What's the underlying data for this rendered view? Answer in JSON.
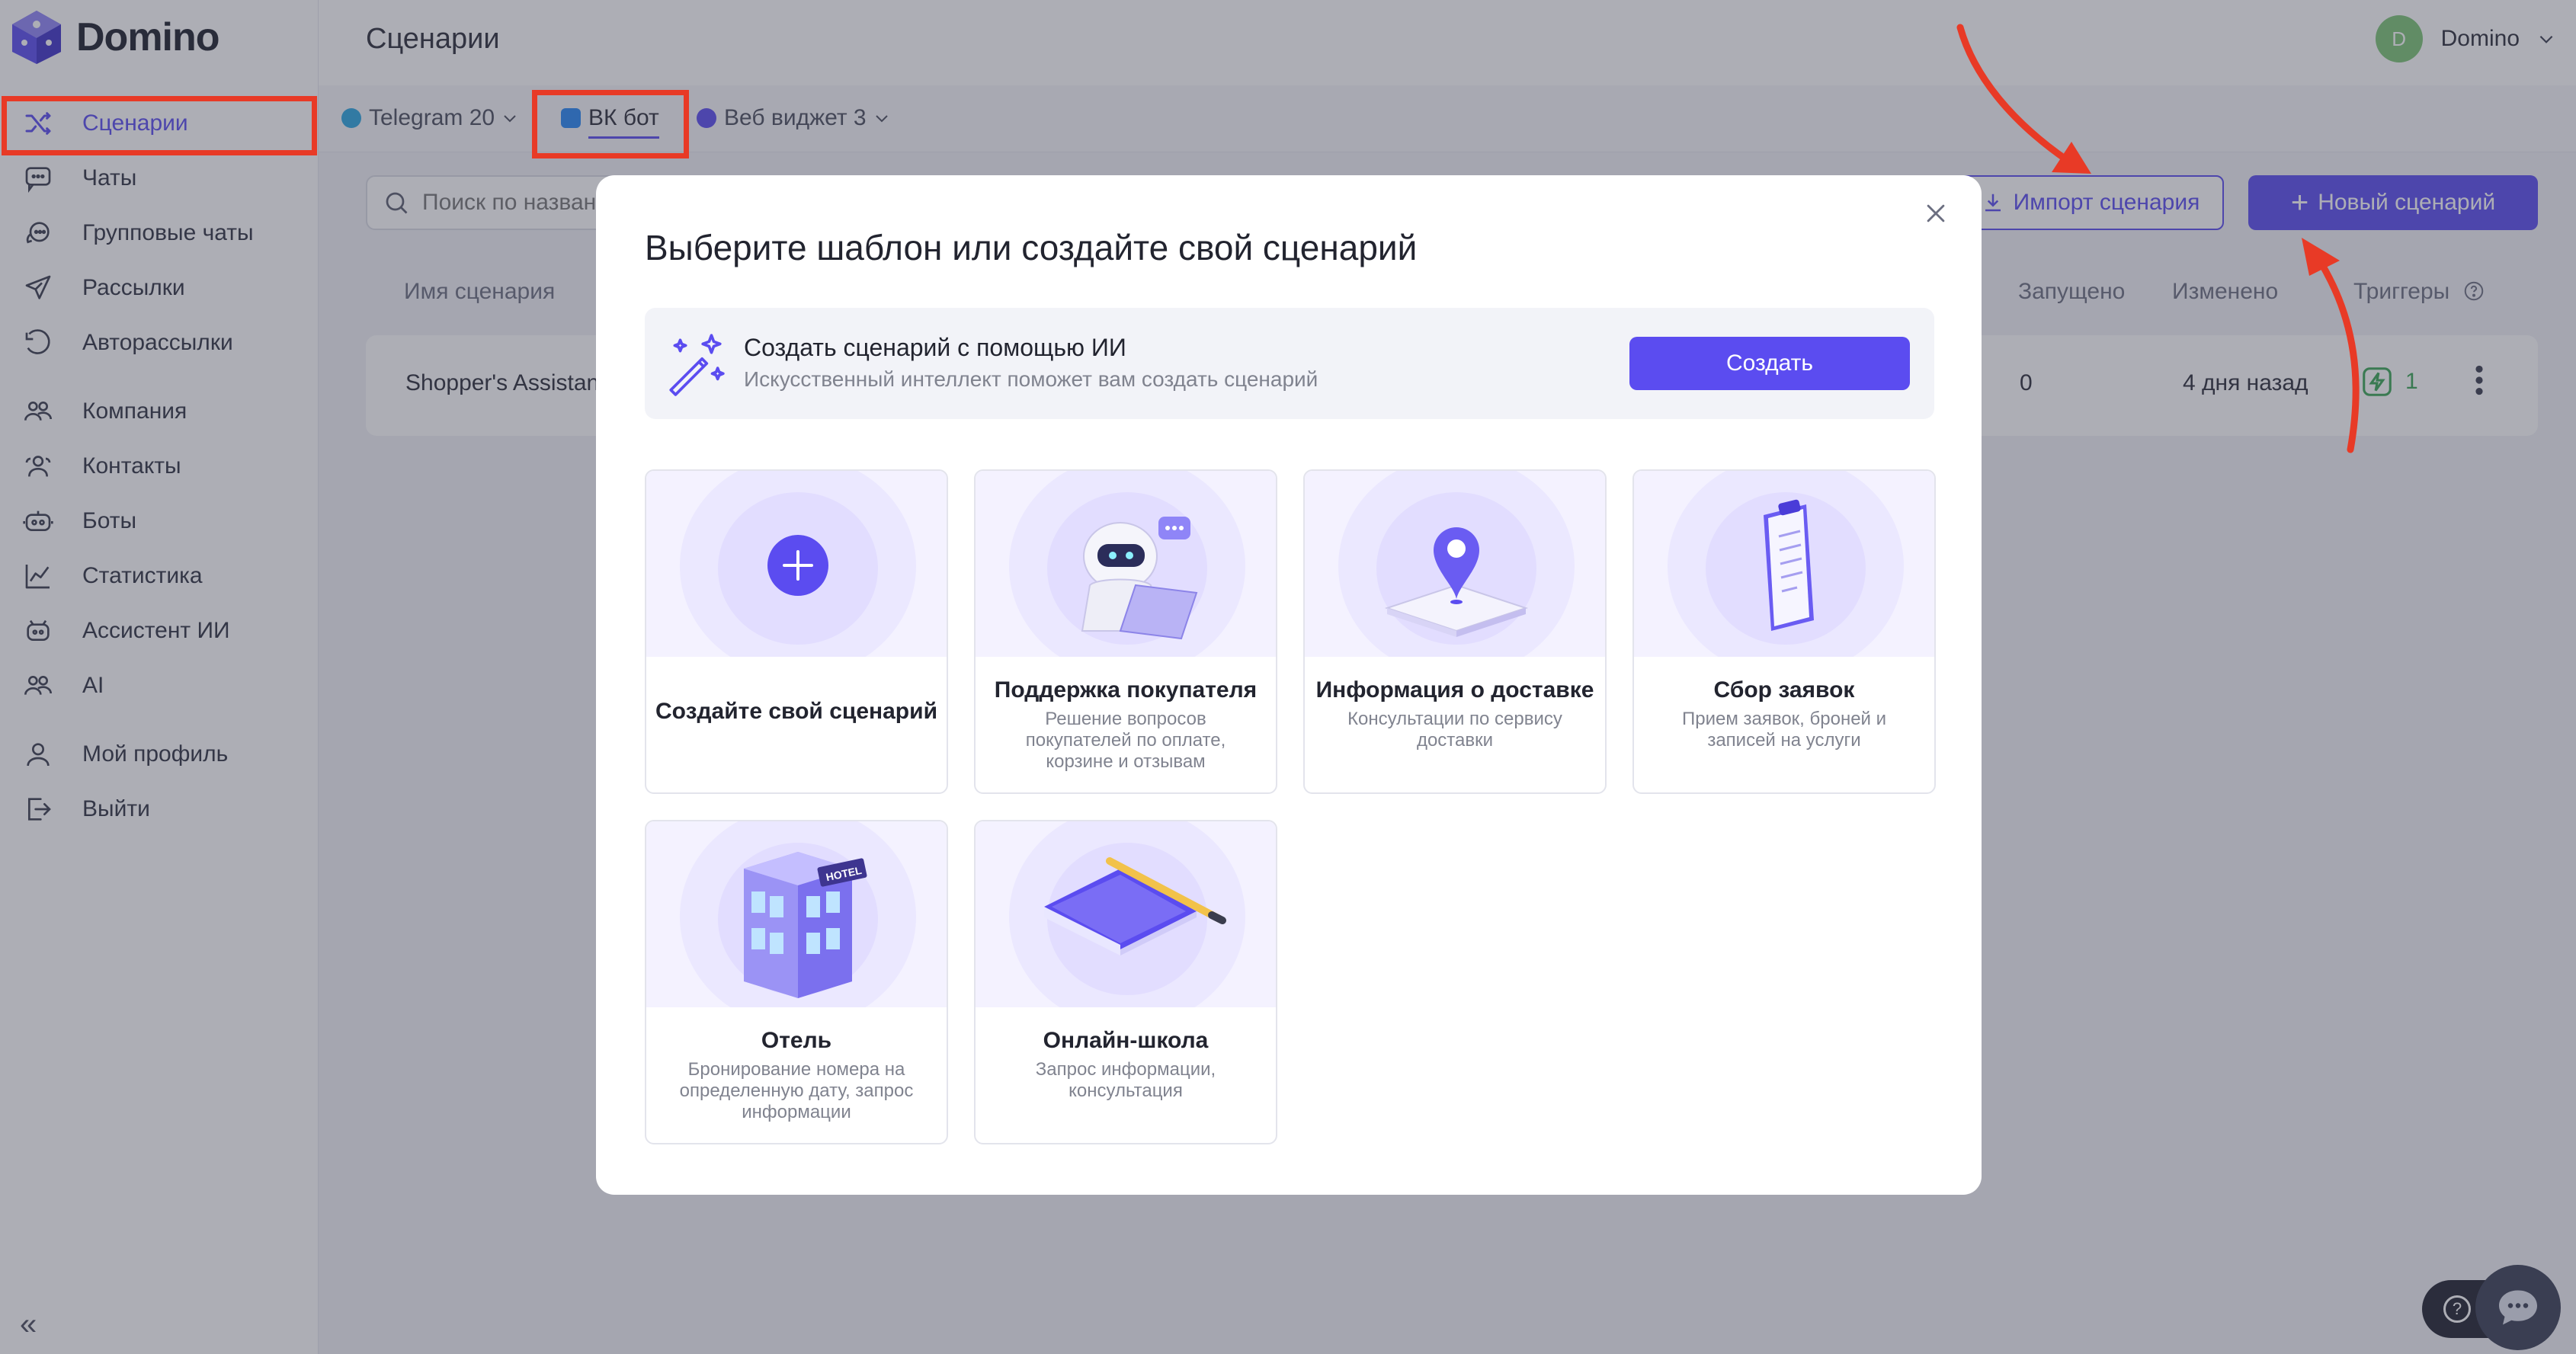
{
  "app": {
    "name": "Domino"
  },
  "sidebar": {
    "items": [
      {
        "label": "Сценарии",
        "icon": "shuffle-icon",
        "active": true
      },
      {
        "label": "Чаты",
        "icon": "chat-icon"
      },
      {
        "label": "Групповые чаты",
        "icon": "group-chat-icon"
      },
      {
        "label": "Рассылки",
        "icon": "send-icon"
      },
      {
        "label": "Авторассылки",
        "icon": "auto-send-icon"
      },
      {
        "label": "Компания",
        "icon": "company-icon"
      },
      {
        "label": "Контакты",
        "icon": "contacts-icon"
      },
      {
        "label": "Боты",
        "icon": "bot-icon"
      },
      {
        "label": "Статистика",
        "icon": "chart-icon"
      },
      {
        "label": "Ассистент ИИ",
        "icon": "ai-assistant-icon"
      },
      {
        "label": "AI",
        "icon": "ai-icon"
      },
      {
        "label": "Мой профиль",
        "icon": "profile-icon"
      },
      {
        "label": "Выйти",
        "icon": "logout-icon"
      }
    ],
    "collapse_label": "«"
  },
  "header": {
    "title": "Сценарии",
    "user": {
      "initial": "D",
      "name": "Domino"
    }
  },
  "tabs": [
    {
      "label": "Telegram 20",
      "color": "#2ca5e0"
    },
    {
      "label": "ВК бот",
      "color": "#2787f5",
      "active": true
    },
    {
      "label": "Веб виджет 3",
      "color": "#5b4cf0"
    }
  ],
  "toolbar": {
    "search_placeholder": "Поиск по названию",
    "import_label": "Импорт сценария",
    "new_label": "Новый сценарий"
  },
  "table": {
    "headers": {
      "name": "Имя сценария",
      "launched": "Запущено",
      "changed": "Изменено",
      "triggers": "Триггеры"
    },
    "rows": [
      {
        "name": "Shopper's Assistant",
        "launched": "0",
        "changed": "4 дня назад",
        "triggers": "1"
      }
    ]
  },
  "modal": {
    "title": "Выберите шаблон или создайте свой сценарий",
    "ai_banner": {
      "title": "Создать сценарий с помощью ИИ",
      "subtitle": "Искусственный интеллект поможет вам создать сценарий",
      "button": "Создать"
    },
    "cards": [
      {
        "title": "Создайте свой сценарий",
        "description": ""
      },
      {
        "title": "Поддержка покупателя",
        "description": "Решение вопросов покупателей по оплате, корзине и отзывам"
      },
      {
        "title": "Информация о доставке",
        "description": "Консультации по сервису доставки"
      },
      {
        "title": "Сбор заявок",
        "description": "Прием заявок, броней и записей на услуги"
      },
      {
        "title": "Отель",
        "description": "Бронирование номера на определенную дату, запрос информации",
        "art_label": "HOTEL"
      },
      {
        "title": "Онлайн-школа",
        "description": "Запрос информации, консультация"
      }
    ]
  },
  "colors": {
    "accent": "#5b4cf0",
    "annotation": "#e83a26",
    "success": "#3aa655"
  },
  "help": {
    "label": "?"
  }
}
